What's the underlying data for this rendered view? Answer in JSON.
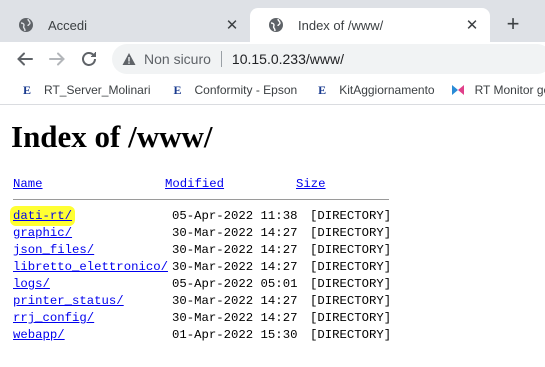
{
  "tabs": [
    {
      "title": "Accedi",
      "active": false,
      "icon": "globe-icon"
    },
    {
      "title": "Index of /www/",
      "active": true,
      "icon": "globe-icon"
    }
  ],
  "toolbar": {
    "security_text": "Non sicuro",
    "url": "10.15.0.233/www/"
  },
  "bookmarks": [
    {
      "label": "RT_Server_Molinari",
      "icon": "E"
    },
    {
      "label": "Conformity - Epson",
      "icon": "E"
    },
    {
      "label": "KitAggiornamento",
      "icon": "E"
    },
    {
      "label": "RT Monitor gest",
      "icon": "rt-monitor-icon"
    }
  ],
  "page": {
    "title": "Index of /www/",
    "columns": {
      "name": "Name",
      "modified": "Modified",
      "size": "Size"
    },
    "entries": [
      {
        "name": "dati-rt/",
        "modified": "05-Apr-2022 11:38",
        "size": "[DIRECTORY]",
        "highlighted": true
      },
      {
        "name": "graphic/",
        "modified": "30-Mar-2022 14:27",
        "size": "[DIRECTORY]"
      },
      {
        "name": "json_files/",
        "modified": "30-Mar-2022 14:27",
        "size": "[DIRECTORY]"
      },
      {
        "name": "libretto_elettronico/",
        "modified": "30-Mar-2022 14:27",
        "size": "[DIRECTORY]"
      },
      {
        "name": "logs/",
        "modified": "05-Apr-2022 05:01",
        "size": "[DIRECTORY]"
      },
      {
        "name": "printer_status/",
        "modified": "30-Mar-2022 14:27",
        "size": "[DIRECTORY]"
      },
      {
        "name": "rrj_config/",
        "modified": "30-Mar-2022 14:27",
        "size": "[DIRECTORY]"
      },
      {
        "name": "webapp/",
        "modified": "01-Apr-2022 15:30",
        "size": "[DIRECTORY]"
      }
    ]
  },
  "colors": {
    "highlight": "#ffff33",
    "link": "#0000ee",
    "tabstrip": "#dee1e6"
  }
}
